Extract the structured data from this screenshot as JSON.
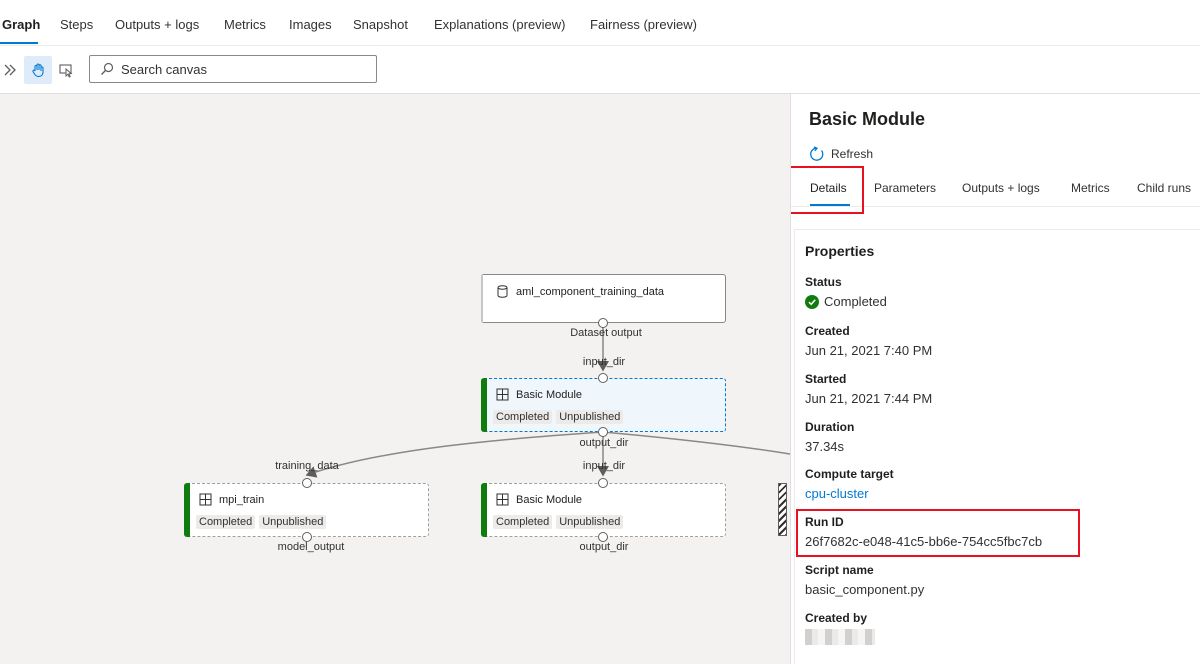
{
  "top_tabs": [
    "Graph",
    "Steps",
    "Outputs + logs",
    "Metrics",
    "Images",
    "Snapshot",
    "Explanations (preview)",
    "Fairness (preview)"
  ],
  "toolbar": {
    "search_placeholder": "Search canvas",
    "icons": [
      "expand-chevrons-icon",
      "pan-hand-icon",
      "select-pointer-icon",
      "search-icon"
    ]
  },
  "canvas": {
    "dataset_node": {
      "title": "aml_component_training_data",
      "output_port": "Dataset output"
    },
    "basic_module_main": {
      "title": "Basic Module",
      "input_port": "input_dir",
      "output_port": "output_dir",
      "status": "Completed",
      "publish": "Unpublished"
    },
    "mpi_train": {
      "title": "mpi_train",
      "input_port": "training_data",
      "output_port": "model_output",
      "status": "Completed",
      "publish": "Unpublished"
    },
    "basic_module_2": {
      "title": "Basic Module",
      "input_port": "input_dir",
      "output_port": "output_dir",
      "status": "Completed",
      "publish": "Unpublished"
    }
  },
  "panel": {
    "title": "Basic Module",
    "refresh_label": "Refresh",
    "tabs": [
      "Details",
      "Parameters",
      "Outputs + logs",
      "Metrics",
      "Child runs"
    ],
    "active_tab": "Details",
    "properties_heading": "Properties",
    "properties": {
      "status": {
        "label": "Status",
        "value": "Completed"
      },
      "created": {
        "label": "Created",
        "value": "Jun 21, 2021 7:40 PM"
      },
      "started": {
        "label": "Started",
        "value": "Jun 21, 2021 7:44 PM"
      },
      "duration": {
        "label": "Duration",
        "value": "37.34s"
      },
      "compute_target": {
        "label": "Compute target",
        "value": "cpu-cluster"
      },
      "run_id": {
        "label": "Run ID",
        "value": "26f7682c-e048-41c5-bb6e-754cc5fbc7cb"
      },
      "script_name": {
        "label": "Script name",
        "value": "basic_component.py"
      },
      "created_by": {
        "label": "Created by"
      }
    }
  },
  "colors": {
    "accent": "#0078d4",
    "success": "#107c10",
    "highlight": "#e81123"
  }
}
